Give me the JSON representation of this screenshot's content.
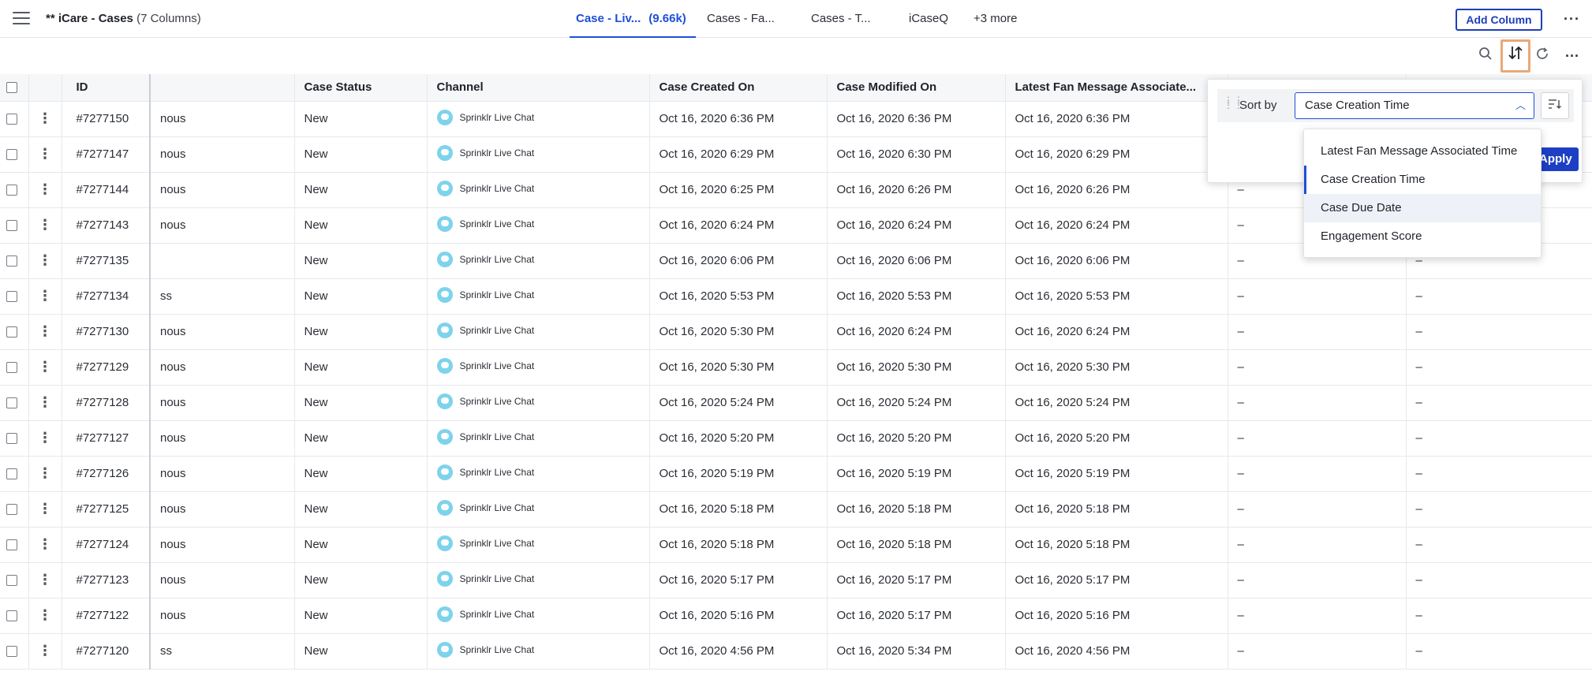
{
  "header": {
    "title": "** iCare - Cases",
    "column_count": "(7 Columns)",
    "tabs": [
      {
        "label": "Case - Liv...",
        "count": "(9.66k)",
        "active": true
      },
      {
        "label": "Cases - Fa..."
      },
      {
        "label": "Cases - T..."
      },
      {
        "label": "iCaseQ"
      },
      {
        "label": "+3 more"
      }
    ],
    "add_column_label": "Add Column",
    "more_glyph": "···"
  },
  "toolbar": {
    "icons": [
      "search-icon",
      "sort-icon",
      "refresh-icon",
      "more-icon"
    ]
  },
  "table": {
    "columns": [
      "ID",
      "",
      "Case Status",
      "Channel",
      "Case Created On",
      "Case Modified On",
      "Latest Fan Message Associate...",
      "",
      ""
    ],
    "rows": [
      {
        "id": "#7277150",
        "name": "nous",
        "status": "New",
        "channel": "Sprinklr Live Chat",
        "created": "Oct 16, 2020 6:36 PM",
        "modified": "Oct 16, 2020 6:36 PM",
        "latest": "Oct 16, 2020 6:36 PM",
        "c8": "",
        "c9": ""
      },
      {
        "id": "#7277147",
        "name": "nous",
        "status": "New",
        "channel": "Sprinklr Live Chat",
        "created": "Oct 16, 2020 6:29 PM",
        "modified": "Oct 16, 2020 6:30 PM",
        "latest": "Oct 16, 2020 6:29 PM",
        "c8": "",
        "c9": ""
      },
      {
        "id": "#7277144",
        "name": "nous",
        "status": "New",
        "channel": "Sprinklr Live Chat",
        "created": "Oct 16, 2020 6:25 PM",
        "modified": "Oct 16, 2020 6:26 PM",
        "latest": "Oct 16, 2020 6:26 PM",
        "c8": "–",
        "c9": ""
      },
      {
        "id": "#7277143",
        "name": "nous",
        "status": "New",
        "channel": "Sprinklr Live Chat",
        "created": "Oct 16, 2020 6:24 PM",
        "modified": "Oct 16, 2020 6:24 PM",
        "latest": "Oct 16, 2020 6:24 PM",
        "c8": "–",
        "c9": ""
      },
      {
        "id": "#7277135",
        "name": "",
        "status": "New",
        "channel": "Sprinklr Live Chat",
        "created": "Oct 16, 2020 6:06 PM",
        "modified": "Oct 16, 2020 6:06 PM",
        "latest": "Oct 16, 2020 6:06 PM",
        "c8": "–",
        "c9": "–"
      },
      {
        "id": "#7277134",
        "name": "ss",
        "status": "New",
        "channel": "Sprinklr Live Chat",
        "created": "Oct 16, 2020 5:53 PM",
        "modified": "Oct 16, 2020 5:53 PM",
        "latest": "Oct 16, 2020 5:53 PM",
        "c8": "–",
        "c9": "–"
      },
      {
        "id": "#7277130",
        "name": "nous",
        "status": "New",
        "channel": "Sprinklr Live Chat",
        "created": "Oct 16, 2020 5:30 PM",
        "modified": "Oct 16, 2020 6:24 PM",
        "latest": "Oct 16, 2020 6:24 PM",
        "c8": "–",
        "c9": "–"
      },
      {
        "id": "#7277129",
        "name": "nous",
        "status": "New",
        "channel": "Sprinklr Live Chat",
        "created": "Oct 16, 2020 5:30 PM",
        "modified": "Oct 16, 2020 5:30 PM",
        "latest": "Oct 16, 2020 5:30 PM",
        "c8": "–",
        "c9": "–"
      },
      {
        "id": "#7277128",
        "name": "nous",
        "status": "New",
        "channel": "Sprinklr Live Chat",
        "created": "Oct 16, 2020 5:24 PM",
        "modified": "Oct 16, 2020 5:24 PM",
        "latest": "Oct 16, 2020 5:24 PM",
        "c8": "–",
        "c9": "–"
      },
      {
        "id": "#7277127",
        "name": "nous",
        "status": "New",
        "channel": "Sprinklr Live Chat",
        "created": "Oct 16, 2020 5:20 PM",
        "modified": "Oct 16, 2020 5:20 PM",
        "latest": "Oct 16, 2020 5:20 PM",
        "c8": "–",
        "c9": "–"
      },
      {
        "id": "#7277126",
        "name": "nous",
        "status": "New",
        "channel": "Sprinklr Live Chat",
        "created": "Oct 16, 2020 5:19 PM",
        "modified": "Oct 16, 2020 5:19 PM",
        "latest": "Oct 16, 2020 5:19 PM",
        "c8": "–",
        "c9": "–"
      },
      {
        "id": "#7277125",
        "name": "nous",
        "status": "New",
        "channel": "Sprinklr Live Chat",
        "created": "Oct 16, 2020 5:18 PM",
        "modified": "Oct 16, 2020 5:18 PM",
        "latest": "Oct 16, 2020 5:18 PM",
        "c8": "–",
        "c9": "–"
      },
      {
        "id": "#7277124",
        "name": "nous",
        "status": "New",
        "channel": "Sprinklr Live Chat",
        "created": "Oct 16, 2020 5:18 PM",
        "modified": "Oct 16, 2020 5:18 PM",
        "latest": "Oct 16, 2020 5:18 PM",
        "c8": "–",
        "c9": "–"
      },
      {
        "id": "#7277123",
        "name": "nous",
        "status": "New",
        "channel": "Sprinklr Live Chat",
        "created": "Oct 16, 2020 5:17 PM",
        "modified": "Oct 16, 2020 5:17 PM",
        "latest": "Oct 16, 2020 5:17 PM",
        "c8": "–",
        "c9": "–"
      },
      {
        "id": "#7277122",
        "name": "nous",
        "status": "New",
        "channel": "Sprinklr Live Chat",
        "created": "Oct 16, 2020 5:16 PM",
        "modified": "Oct 16, 2020 5:17 PM",
        "latest": "Oct 16, 2020 5:16 PM",
        "c8": "–",
        "c9": "–"
      },
      {
        "id": "#7277120",
        "name": "ss",
        "status": "New",
        "channel": "Sprinklr Live Chat",
        "created": "Oct 16, 2020 4:56 PM",
        "modified": "Oct 16, 2020 5:34 PM",
        "latest": "Oct 16, 2020 4:56 PM",
        "c8": "–",
        "c9": "–"
      }
    ]
  },
  "sort_popover": {
    "label": "Sort by",
    "selected": "Case Creation Time",
    "apply_label": "Apply",
    "options": [
      {
        "label": "Latest Fan Message Associated Time",
        "selected": false,
        "hover": false
      },
      {
        "label": "Case Creation Time",
        "selected": true,
        "hover": false
      },
      {
        "label": "Case Due Date",
        "selected": false,
        "hover": true
      },
      {
        "label": "Engagement Score",
        "selected": false,
        "hover": false
      }
    ]
  },
  "colors": {
    "accent": "#1d4fd8",
    "apply_bg": "#1d3fc4",
    "sort_highlight": "#eaa877",
    "chat_icon": "#7ed3ec"
  }
}
